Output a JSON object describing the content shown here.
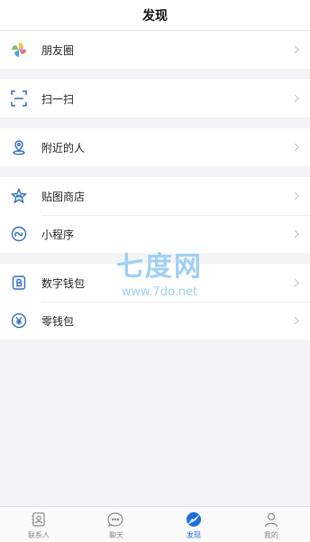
{
  "header": {
    "title": "发现"
  },
  "groups": [
    {
      "items": [
        {
          "label": "朋友圈",
          "icon": "moments-icon"
        }
      ]
    },
    {
      "items": [
        {
          "label": "扫一扫",
          "icon": "scan-icon"
        }
      ]
    },
    {
      "items": [
        {
          "label": "附近的人",
          "icon": "location-pin-icon"
        }
      ]
    },
    {
      "items": [
        {
          "label": "贴图商店",
          "icon": "sticker-store-icon"
        },
        {
          "label": "小程序",
          "icon": "mini-program-icon"
        }
      ]
    },
    {
      "items": [
        {
          "label": "数字钱包",
          "icon": "digital-wallet-icon"
        },
        {
          "label": "零钱包",
          "icon": "yuan-wallet-icon"
        }
      ]
    }
  ],
  "watermark": {
    "title": "七度网",
    "url": "www.7do.net"
  },
  "tabs": [
    {
      "label": "联系人",
      "icon": "contacts-icon",
      "active": false
    },
    {
      "label": "聊天",
      "icon": "chat-icon",
      "active": false
    },
    {
      "label": "发现",
      "icon": "discover-icon",
      "active": true
    },
    {
      "label": "我的",
      "icon": "profile-icon",
      "active": false
    }
  ],
  "colors": {
    "accent": "#1e6fd9",
    "icon_blue": "#2f6fbd",
    "background": "#f4f4f6"
  }
}
